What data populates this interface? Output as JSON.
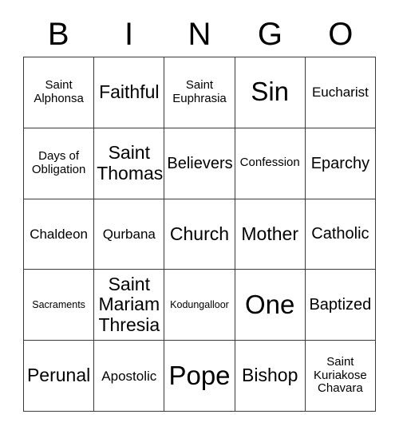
{
  "card": {
    "headers": [
      "B",
      "I",
      "N",
      "G",
      "O"
    ],
    "rows": [
      [
        {
          "text": "Saint\nAlphonsa",
          "size": "sm"
        },
        {
          "text": "Faithful",
          "size": "xl"
        },
        {
          "text": "Saint\nEuphrasia",
          "size": "sm"
        },
        {
          "text": "Sin",
          "size": "xxl"
        },
        {
          "text": "Eucharist",
          "size": "md"
        }
      ],
      [
        {
          "text": "Days of\nObligation",
          "size": "sm"
        },
        {
          "text": "Saint\nThomas",
          "size": "xl"
        },
        {
          "text": "Believers",
          "size": "lg"
        },
        {
          "text": "Confession",
          "size": "sm"
        },
        {
          "text": "Eparchy",
          "size": "lg"
        }
      ],
      [
        {
          "text": "Chaldeon",
          "size": "md"
        },
        {
          "text": "Qurbana",
          "size": "md"
        },
        {
          "text": "Church",
          "size": "xl"
        },
        {
          "text": "Mother",
          "size": "xl"
        },
        {
          "text": "Catholic",
          "size": "lg"
        }
      ],
      [
        {
          "text": "Sacraments",
          "size": "xs"
        },
        {
          "text": "Saint\nMariam\nThresia",
          "size": "xl"
        },
        {
          "text": "Kodungalloor",
          "size": "xs"
        },
        {
          "text": "One",
          "size": "xxl"
        },
        {
          "text": "Baptized",
          "size": "lg"
        }
      ],
      [
        {
          "text": "Perunal",
          "size": "xl"
        },
        {
          "text": "Apostolic",
          "size": "md"
        },
        {
          "text": "Pope",
          "size": "xxl"
        },
        {
          "text": "Bishop",
          "size": "xl"
        },
        {
          "text": "Saint\nKuriakose\nChavara",
          "size": "sm"
        }
      ]
    ]
  },
  "colors": {
    "border": "#3a3a3a",
    "text": "#000000",
    "background": "#ffffff"
  }
}
